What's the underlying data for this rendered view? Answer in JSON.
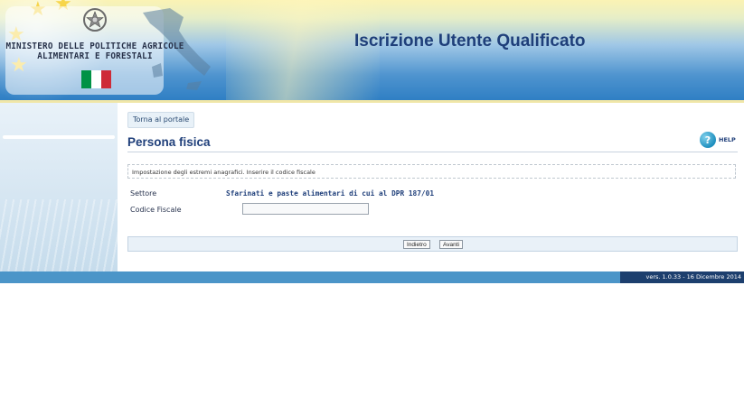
{
  "header": {
    "ministry_line1": "MINISTERO DELLE POLITICHE AGRICOLE",
    "ministry_line2": "ALIMENTARI E FORESTALI",
    "app_title": "Iscrizione Utente Qualificato",
    "flag_colors": [
      "#009246",
      "#ffffff",
      "#ce2b37"
    ],
    "emblem_icon": "italian-republic-emblem-icon"
  },
  "main": {
    "back_link": "Torna al portale",
    "page_title": "Persona fisica",
    "help_label": "HELP",
    "help_icon_glyph": "?",
    "info_text": "Impostazione degli estremi anagrafici. Inserire il codice fiscale",
    "fields": {
      "settore_label": "Settore",
      "settore_value": "Sfarinati e paste alimentari di cui al DPR 187/01",
      "codice_fiscale_label": "Codice Fiscale",
      "codice_fiscale_value": ""
    },
    "buttons": {
      "back": "Indietro",
      "next": "Avanti"
    }
  },
  "footer": {
    "version": "vers. 1.0.33 - 16 Dicembre 2014"
  },
  "colors": {
    "title_blue": "#1f3f7a",
    "footer_blue": "#4b95c8",
    "version_bg": "#1d3f6e"
  }
}
